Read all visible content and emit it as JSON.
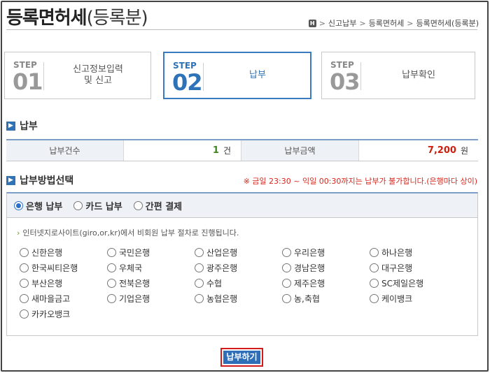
{
  "header": {
    "title_main": "등록면허세",
    "title_sub": "(등록분)",
    "breadcrumb": [
      "신고납부",
      "등록면허세",
      "등록면허세(등록분)"
    ],
    "home_icon": "home-icon"
  },
  "steps": [
    {
      "label": "STEP",
      "num": "01",
      "text_line1": "신고정보입력",
      "text_line2": "및 신고"
    },
    {
      "label": "STEP",
      "num": "02",
      "text": "납부"
    },
    {
      "label": "STEP",
      "num": "03",
      "text": "납부확인"
    }
  ],
  "payment": {
    "section_title": "납부",
    "count_label": "납부건수",
    "count_value": "1",
    "count_unit": "건",
    "amount_label": "납부금액",
    "amount_value": "7,200",
    "amount_unit": "원"
  },
  "method": {
    "section_title": "납부방법선택",
    "notice": "※ 금일 23:30 ~ 익일 00:30까지는 납부가 불가합니다.(은행마다 상이)",
    "tabs": [
      {
        "label": "은행 납부",
        "selected": true
      },
      {
        "label": "카드 납부",
        "selected": false
      },
      {
        "label": "간편 결제",
        "selected": false
      }
    ],
    "info": "인터넷지로사이트(giro,or,kr)에서 비회원 납부 절차로 진행됩니다.",
    "banks": [
      "신한은행",
      "국민은행",
      "산업은행",
      "우리은행",
      "하나은행",
      "한국씨티은행",
      "우체국",
      "광주은행",
      "경남은행",
      "대구은행",
      "부산은행",
      "전북은행",
      "수협",
      "제주은행",
      "SC제일은행",
      "새마을금고",
      "기업은행",
      "농협은행",
      "농,축협",
      "케이뱅크",
      "카카오뱅크"
    ]
  },
  "pay_button": "납부하기",
  "colors": {
    "accent": "#2f6fb8",
    "notice": "#d9261c",
    "count": "#3a8a18",
    "amount": "#c9200f"
  }
}
